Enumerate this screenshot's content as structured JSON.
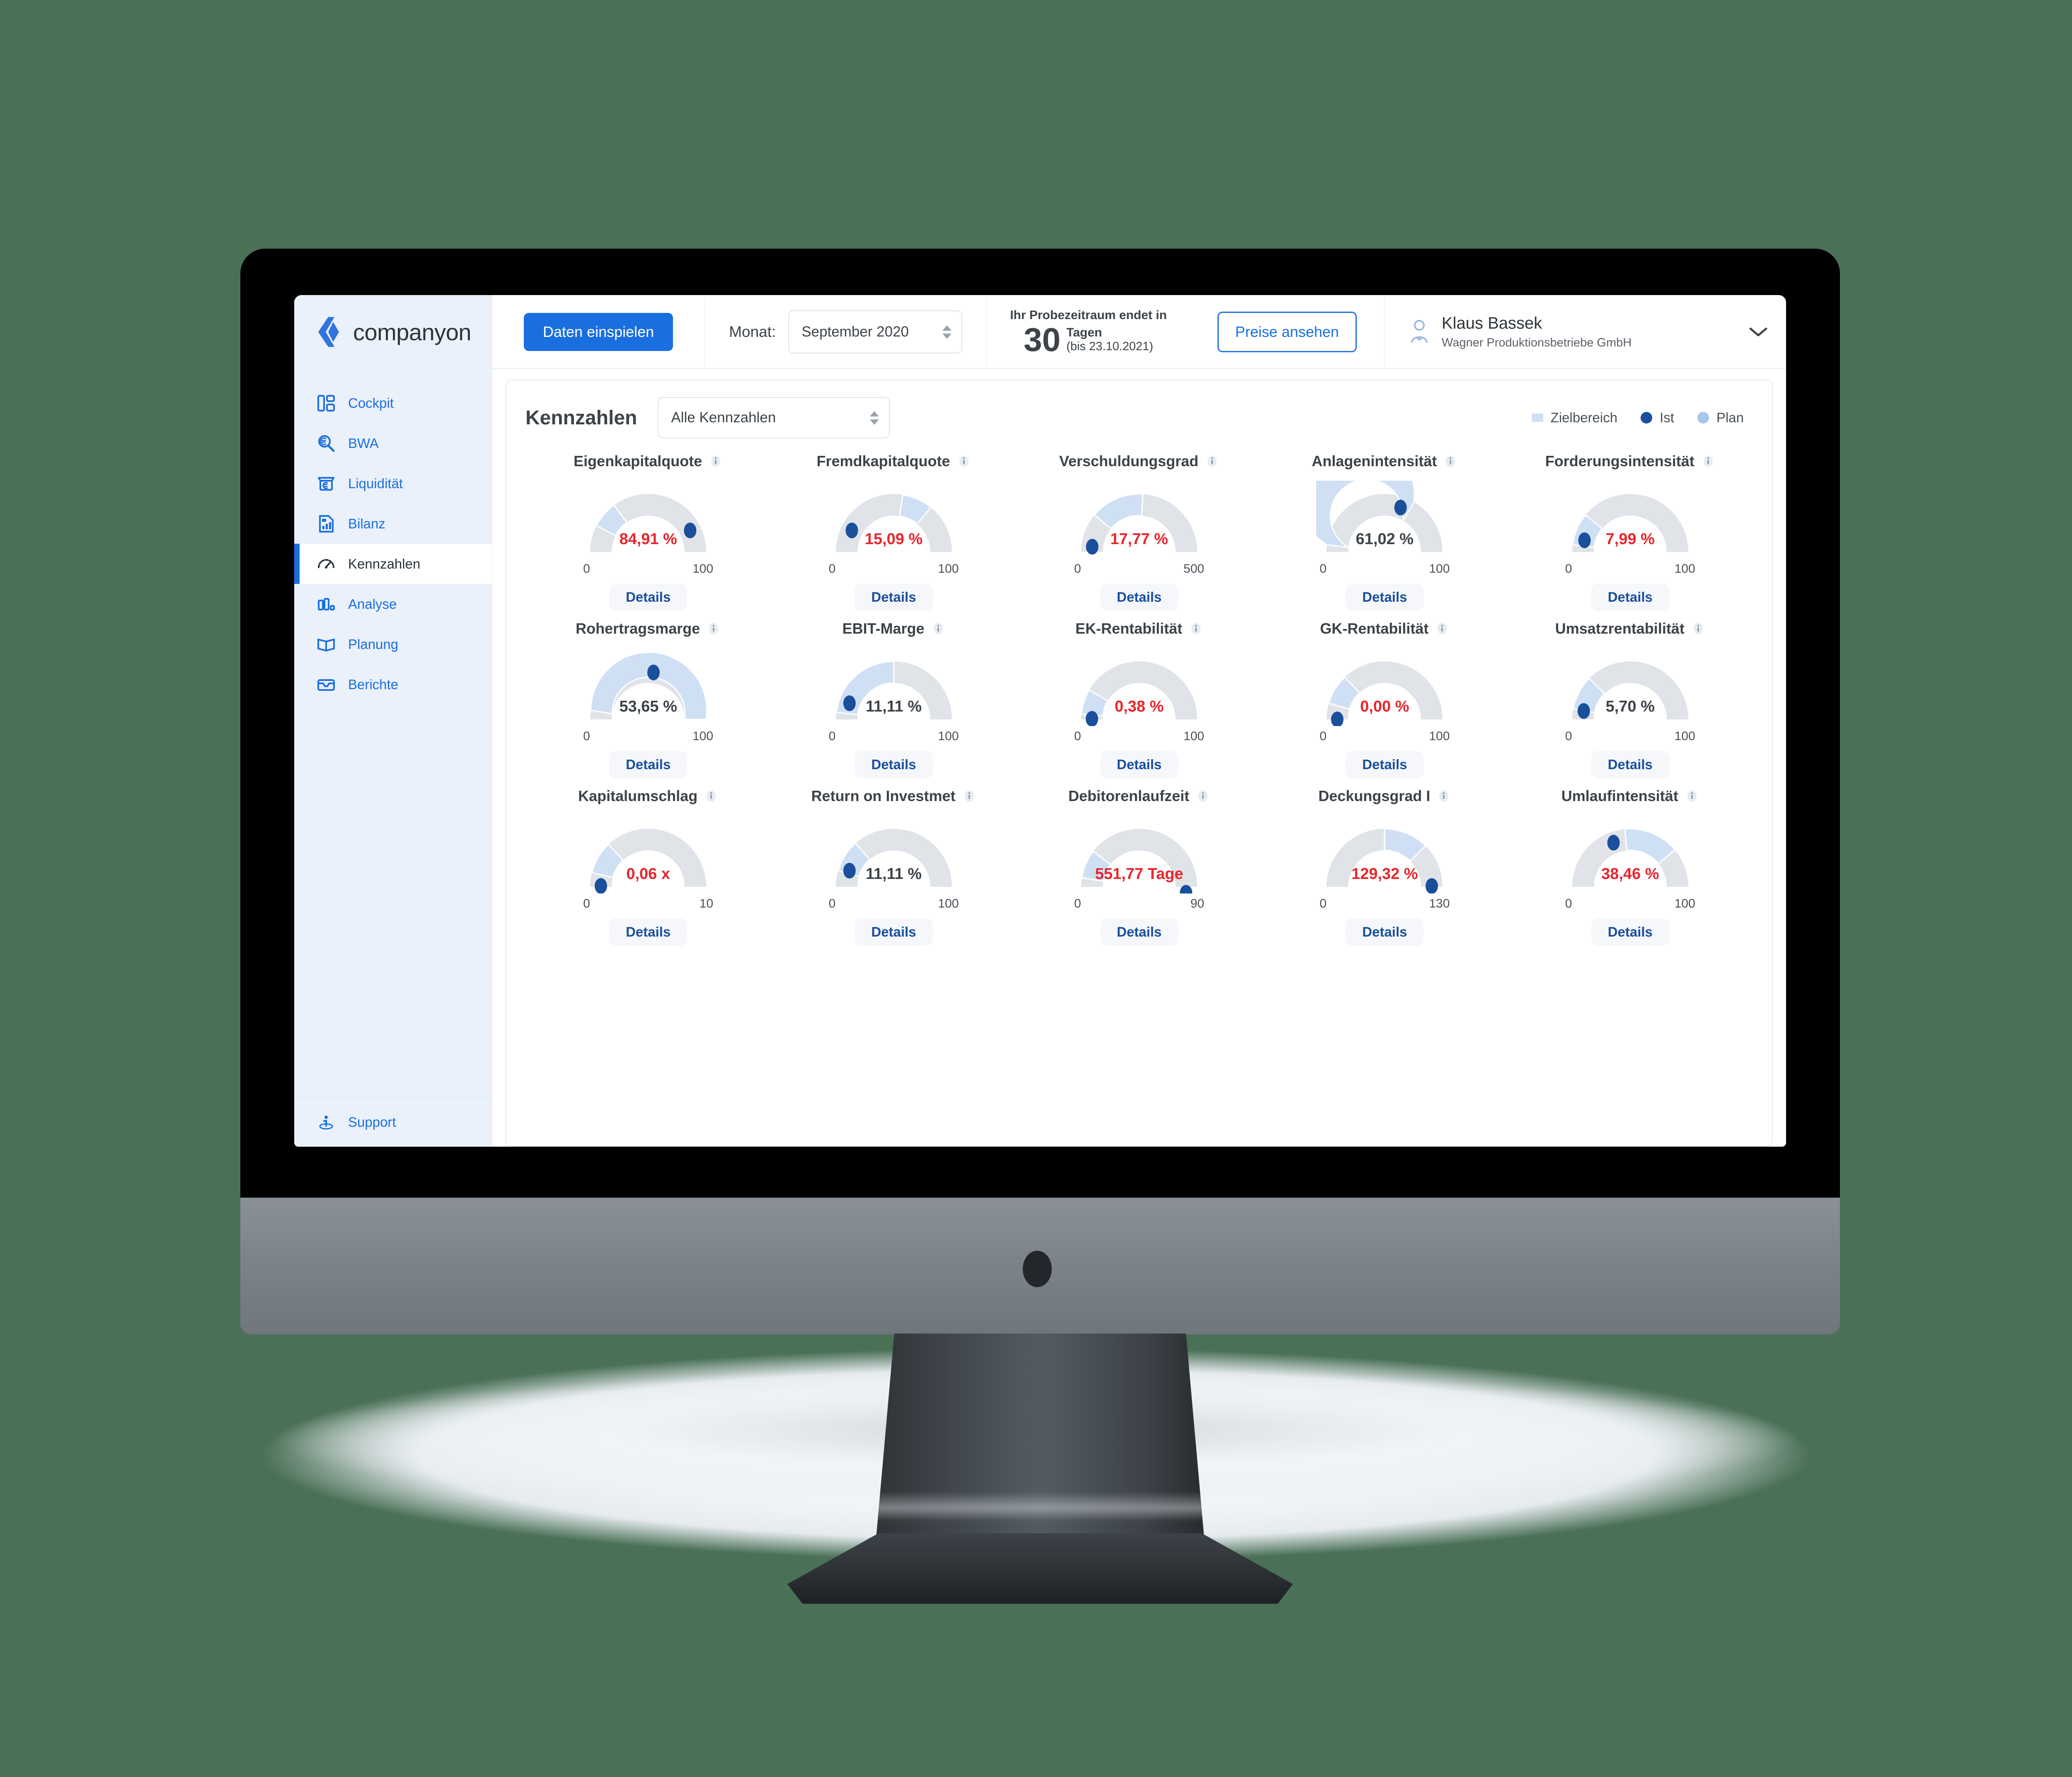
{
  "brand": {
    "name": "companyon",
    "logo_icon": "companyon-logo-icon"
  },
  "topbar": {
    "import_button": "Daten einspielen",
    "month_label": "Monat:",
    "month_value": "September 2020",
    "trial_prefix": "Ihr Probezeitraum endet in",
    "trial_days": "30",
    "trial_days_unit": "Tagen",
    "trial_until": "(bis 23.10.2021)",
    "pricing_button": "Preise ansehen",
    "user_name": "Klaus Bassek",
    "company": "Wagner Produktionsbetriebe GmbH",
    "user_icon": "user-avatar-icon",
    "chevron_icon": "chevron-down-icon"
  },
  "sidebar": {
    "items": [
      {
        "label": "Cockpit",
        "icon": "dashboard-icon",
        "active": false
      },
      {
        "label": "BWA",
        "icon": "search-euro-icon",
        "active": false
      },
      {
        "label": "Liquidität",
        "icon": "atm-euro-icon",
        "active": false
      },
      {
        "label": "Bilanz",
        "icon": "report-icon",
        "active": false
      },
      {
        "label": "Kennzahlen",
        "icon": "gauge-icon",
        "active": true
      },
      {
        "label": "Analyse",
        "icon": "bar-chart-icon",
        "active": false
      },
      {
        "label": "Planung",
        "icon": "book-icon",
        "active": false
      },
      {
        "label": "Berichte",
        "icon": "inbox-icon",
        "active": false
      }
    ],
    "support": {
      "label": "Support",
      "icon": "info-pin-icon"
    }
  },
  "panel": {
    "title": "Kennzahlen",
    "filter_value": "Alle Kennzahlen",
    "legend": [
      {
        "label": "Zielbereich",
        "swatch": "square",
        "color": "#cfe0f4"
      },
      {
        "label": "Ist",
        "swatch": "dot",
        "color": "#1a4f9c"
      },
      {
        "label": "Plan",
        "swatch": "dot",
        "color": "#a8c7ec"
      }
    ],
    "details_label": "Details",
    "info_icon": "info-icon"
  },
  "colors": {
    "accent": "#1a6fe0",
    "ist_dot": "#1a4f9c",
    "target_band": "#cfe0f4",
    "track": "#e0e3e8",
    "value_red": "#e8252c",
    "value_dark": "#3d4348",
    "sidebar_bg": "#eaf1fb"
  },
  "chart_data": {
    "type": "gauge",
    "title": "Kennzahlen",
    "unit_note": "Half-circle gauges: grey track = full scale, light-blue arc = Zielbereich (target band), dark blue dot = Ist (actual)",
    "gauges": [
      {
        "name": "Eigenkapitalquote",
        "value": 84.91,
        "display": "84,91 %",
        "unit": "%",
        "min": 0,
        "max": 100,
        "min_label": "0",
        "max_label": "100",
        "target_from": 15,
        "target_to": 30,
        "status": "red"
      },
      {
        "name": "Fremdkapitalquote",
        "value": 15.09,
        "display": "15,09 %",
        "unit": "%",
        "min": 0,
        "max": 100,
        "min_label": "0",
        "max_label": "100",
        "target_from": 55,
        "target_to": 72,
        "status": "red"
      },
      {
        "name": "Verschuldungsgrad",
        "value": 17.77,
        "display": "17,77 %",
        "unit": "%",
        "min": 0,
        "max": 500,
        "min_label": "0",
        "max_label": "500",
        "target_from": 22,
        "target_to": 52,
        "status": "red"
      },
      {
        "name": "Anlagenintensität",
        "value": 61.02,
        "display": "61,02 %",
        "unit": "%",
        "min": 0,
        "max": 100,
        "min_label": "0",
        "max_label": "100",
        "target_from": 4,
        "target_to": 67,
        "status": "dark"
      },
      {
        "name": "Forderungsintensität",
        "value": 7.99,
        "display": "7,99 %",
        "unit": "%",
        "min": 0,
        "max": 100,
        "min_label": "0",
        "max_label": "100",
        "target_from": 4,
        "target_to": 22,
        "status": "red"
      },
      {
        "name": "Rohertragsmarge",
        "value": 53.65,
        "display": "53,65 %",
        "unit": "%",
        "min": 0,
        "max": 100,
        "min_label": "0",
        "max_label": "100",
        "target_from": 5,
        "target_to": 100,
        "status": "dark"
      },
      {
        "name": "EBIT-Marge",
        "value": 11.11,
        "display": "11,11 %",
        "unit": "%",
        "min": 0,
        "max": 100,
        "min_label": "0",
        "max_label": "100",
        "target_from": 4,
        "target_to": 50,
        "status": "dark"
      },
      {
        "name": "EK-Rentabilität",
        "value": 0.38,
        "display": "0,38 %",
        "unit": "%",
        "min": 0,
        "max": 100,
        "min_label": "0",
        "max_label": "100",
        "target_from": 3,
        "target_to": 17,
        "status": "red"
      },
      {
        "name": "GK-Rentabilität",
        "value": 0.0,
        "display": "0,00 %",
        "unit": "%",
        "min": 0,
        "max": 100,
        "min_label": "0",
        "max_label": "100",
        "target_from": 9,
        "target_to": 26,
        "status": "red"
      },
      {
        "name": "Umsatzrentabilität",
        "value": 5.7,
        "display": "5,70 %",
        "unit": "%",
        "min": 0,
        "max": 100,
        "min_label": "0",
        "max_label": "100",
        "target_from": 6,
        "target_to": 25,
        "status": "dark"
      },
      {
        "name": "Kapitalumschlag",
        "value": 0.06,
        "display": "0,06 x",
        "unit": "x",
        "min": 0,
        "max": 10,
        "min_label": "0",
        "max_label": "10",
        "target_from": 8,
        "target_to": 26,
        "status": "red"
      },
      {
        "name": "Return on Investmet",
        "value": 11.11,
        "display": "11,11 %",
        "unit": "%",
        "min": 0,
        "max": 100,
        "min_label": "0",
        "max_label": "100",
        "target_from": 9,
        "target_to": 27,
        "status": "dark"
      },
      {
        "name": "Debitorenlaufzeit",
        "value": 551.77,
        "display": "551,77 Tage",
        "unit": "Tage",
        "min": 0,
        "max": 90,
        "min_label": "0",
        "max_label": "90",
        "target_from": 5,
        "target_to": 21,
        "status": "red"
      },
      {
        "name": "Deckungsgrad I",
        "value": 129.32,
        "display": "129,32 %",
        "unit": "%",
        "min": 0,
        "max": 130,
        "min_label": "0",
        "max_label": "130",
        "target_from": 50,
        "target_to": 75,
        "status": "red"
      },
      {
        "name": "Umlaufintensität",
        "value": 38.46,
        "display": "38,46 %",
        "unit": "%",
        "min": 0,
        "max": 100,
        "min_label": "0",
        "max_label": "100",
        "target_from": 47,
        "target_to": 78,
        "status": "red"
      }
    ]
  }
}
